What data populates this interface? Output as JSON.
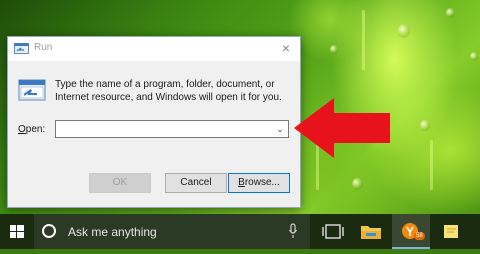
{
  "dialog": {
    "title": "Run",
    "close_glyph": "×",
    "description": "Type the name of a program, folder, document, or Internet resource, and Windows will open it for you.",
    "open_label_underlined": "O",
    "open_label_rest": "pen:",
    "open_value": "",
    "dropdown_glyph": "⌄",
    "ok_label": "OK",
    "cancel_label": "Cancel",
    "browse_label_underlined": "B",
    "browse_label_rest": "rowse..."
  },
  "taskbar": {
    "search_placeholder": "Ask me anything",
    "icons": [
      "windows-start-icon",
      "cortana-icon",
      "microphone-icon",
      "task-view-icon",
      "file-explorer-icon",
      "app-icon",
      "sticky-notes-icon"
    ],
    "app_badge": "58"
  },
  "colors": {
    "arrow": "#e8121c",
    "taskbar": "#1b2b10",
    "accent": "#0078d7"
  }
}
